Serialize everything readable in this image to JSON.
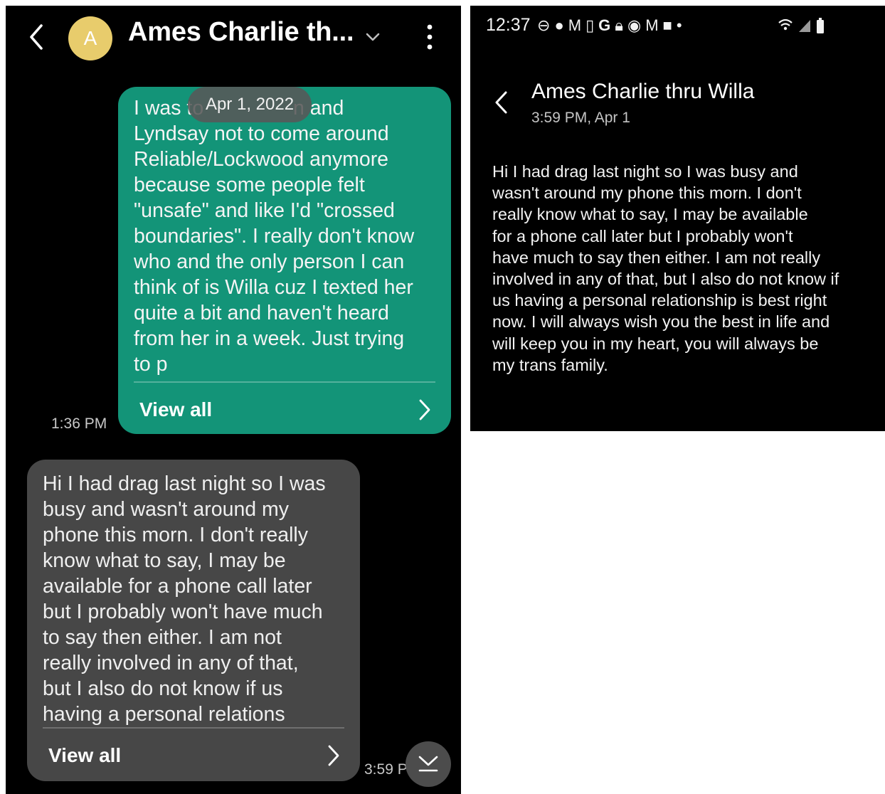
{
  "conversation": {
    "avatar_letter": "A",
    "title": "Ames Charlie th...",
    "date_separator": "Apr 1, 2022",
    "messages": [
      {
        "direction": "sent",
        "text": "I was to\nLyndsay not to come around\nReliable/Lockwood anymore\nbecause some people felt\n\"unsafe\" and like I'd \"crossed\nboundaries\".  I really don't know\nwho and the only person I can\nthink of is Willa cuz I texted her\nquite a bit and haven't heard\nfrom her in a week.  Just trying\nto p",
        "obscured_tail": "n and",
        "view_all_label": "View all",
        "time": "1:36 PM"
      },
      {
        "direction": "received",
        "text": "Hi I had drag last night so I was\nbusy and wasn't around my\nphone this morn. I don't really\nknow what to say, I may be\navailable for a phone call later\nbut I probably won't have much\nto say then either. I am not\nreally involved in any of that,\nbut I also do not know if us\nhaving a personal relations",
        "view_all_label": "View all",
        "time": "3:59 P"
      }
    ],
    "colors": {
      "sent_bubble": "#139478",
      "received_bubble": "#474747",
      "avatar": "#e8cc6c",
      "background": "#000000"
    }
  },
  "detail": {
    "status_time": "12:37",
    "status_icons": [
      "do-not-disturb-icon",
      "profile-icon",
      "gmail-icon",
      "phone-icon",
      "google-icon",
      "lock-icon",
      "sync-icon",
      "gmail-icon",
      "gallery-icon",
      "dot-icon",
      "wifi-icon",
      "signal-icon",
      "battery-icon"
    ],
    "title": "Ames Charlie thru Willa",
    "meta": "3:59 PM, Apr 1",
    "body": "Hi I had drag last night so I was busy and\nwasn't around my phone this morn. I don't\nreally know what to say, I may be available\nfor a phone call later but I probably won't\nhave much to say then either. I am not really\ninvolved in any of that, but I also do not know if\nus having a personal relationship is best right\nnow. I will always wish you the best in life and\nwill keep you in my heart, you will always be\nmy trans family."
  }
}
